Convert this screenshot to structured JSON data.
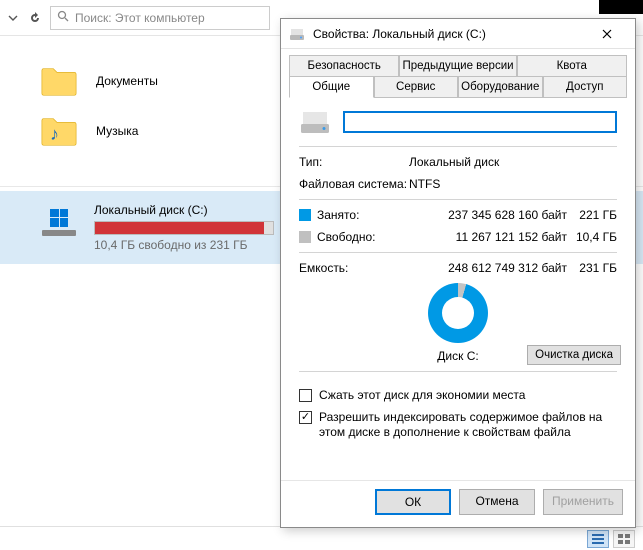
{
  "toolbar": {
    "search_placeholder": "Поиск: Этот компьютер"
  },
  "explorer": {
    "folders": [
      {
        "label": "Документы"
      },
      {
        "label": "Музыка"
      }
    ],
    "drive": {
      "title": "Локальный диск (C:)",
      "subtitle": "10,4 ГБ свободно из 231 ГБ"
    }
  },
  "dialog": {
    "title": "Свойства: Локальный диск (C:)",
    "tabs_top": [
      "Безопасность",
      "Предыдущие версии",
      "Квота"
    ],
    "tabs_bottom": [
      "Общие",
      "Сервис",
      "Оборудование",
      "Доступ"
    ],
    "active_tab": "Общие",
    "name_value": "",
    "type_label": "Тип:",
    "type_value": "Локальный диск",
    "fs_label": "Файловая система:",
    "fs_value": "NTFS",
    "used_label": "Занято:",
    "used_bytes": "237 345 628 160 байт",
    "used_gb": "221 ГБ",
    "free_label": "Свободно:",
    "free_bytes": "11 267 121 152 байт",
    "free_gb": "10,4 ГБ",
    "capacity_label": "Емкость:",
    "capacity_bytes": "248 612 749 312 байт",
    "capacity_gb": "231 ГБ",
    "donut_label": "Диск C:",
    "clean_btn": "Очистка диска",
    "compress_label": "Сжать этот диск для экономии места",
    "index_label": "Разрешить индексировать содержимое файлов на этом диске в дополнение к свойствам файла",
    "ok": "ОК",
    "cancel": "Отмена",
    "apply": "Применить"
  },
  "chart_data": {
    "type": "pie",
    "title": "Диск C:",
    "series": [
      {
        "name": "Занято",
        "value": 237345628160,
        "display": "221 ГБ",
        "color": "#0099e5"
      },
      {
        "name": "Свободно",
        "value": 11267121152,
        "display": "10,4 ГБ",
        "color": "#c4c4c4"
      }
    ],
    "total": {
      "name": "Емкость",
      "value": 248612749312,
      "display": "231 ГБ"
    }
  }
}
